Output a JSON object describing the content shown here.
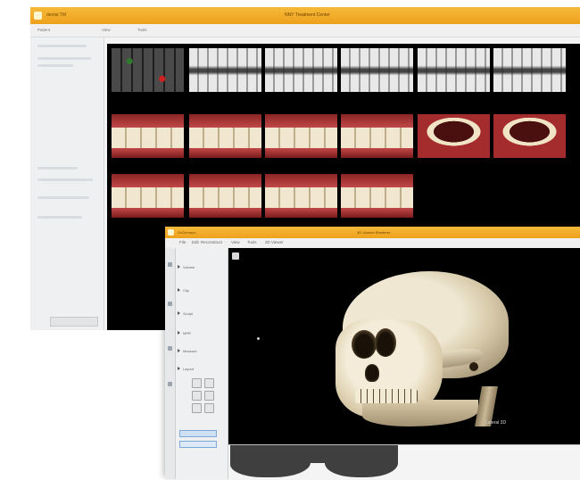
{
  "back_window": {
    "app_label": "dental TM",
    "title": "NNY Treatment Center",
    "toolbar": [
      "Patient",
      "View",
      "Tools"
    ],
    "gallery_rows": [
      [
        "xray-dark",
        "xray",
        "xray",
        "xray",
        "xray",
        "xray"
      ],
      [
        "teeth",
        "teeth",
        "teeth",
        "teeth",
        "teeth-arch",
        "teeth-arch"
      ],
      [
        "teeth",
        "teeth",
        "teeth",
        "teeth"
      ]
    ]
  },
  "front_window": {
    "app_label": "OnDemand",
    "title": "3D Volume Renderer",
    "menu": [
      "File",
      "Edit",
      "Reconstruct",
      "View",
      "Tools",
      "3D Viewer"
    ],
    "sidebar_rows": [
      "Volume",
      "Clip",
      "Sculpt",
      "MPR",
      "Measure",
      "Layout"
    ],
    "viewport_label": "Lateral 3D"
  },
  "colors": {
    "title_bar": "#f0a520",
    "canvas": "#000000"
  }
}
